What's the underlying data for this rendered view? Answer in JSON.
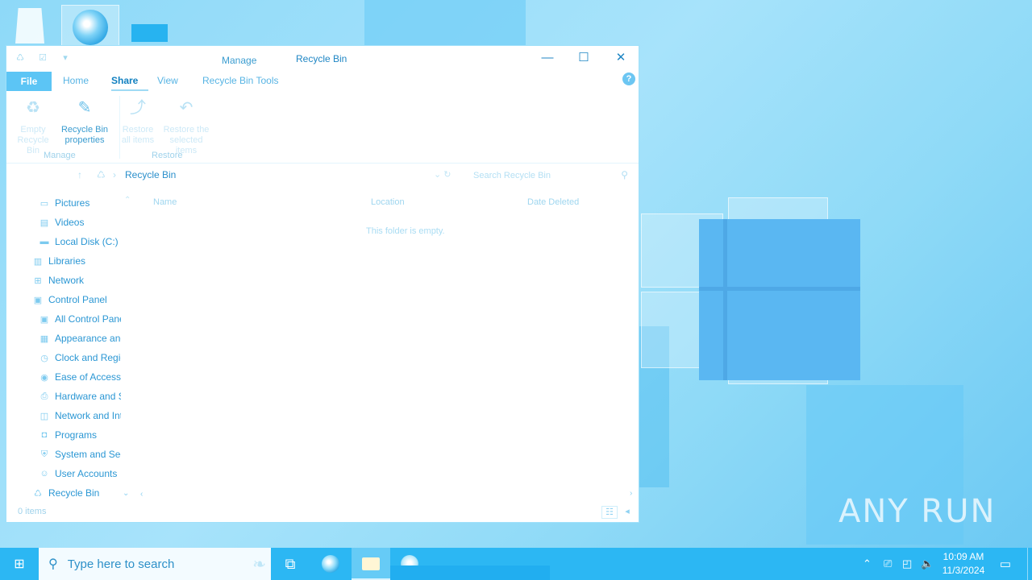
{
  "window": {
    "title": "Recycle Bin",
    "context_tab": "Manage",
    "controls": {
      "minimize": "—",
      "maximize": "☐",
      "close": "✕"
    }
  },
  "quick_access": [
    "♺",
    "☑",
    "▾"
  ],
  "ribbon": {
    "tabs": [
      "File",
      "Home",
      "Share",
      "View",
      "Recycle Bin Tools"
    ],
    "active_tab": "Share",
    "help": "?",
    "buttons": {
      "empty": "Empty Recycle Bin",
      "properties": "Recycle Bin properties",
      "restore_all": "Restore all items",
      "restore_selected": "Restore the selected items"
    },
    "groups": {
      "manage": "Manage",
      "restore": "Restore"
    }
  },
  "address": {
    "path": "Recycle Bin",
    "search_placeholder": "Search Recycle Bin"
  },
  "nav_pane": {
    "items": [
      {
        "label": "Pictures",
        "icon": "pictures-icon"
      },
      {
        "label": "Videos",
        "icon": "videos-icon"
      },
      {
        "label": "Local Disk (C:)",
        "icon": "drive-icon"
      },
      {
        "label": "Libraries",
        "icon": "libraries-icon"
      },
      {
        "label": "Network",
        "icon": "network-icon"
      },
      {
        "label": "Control Panel",
        "icon": "control-panel-icon"
      },
      {
        "label": "All Control Panel Items",
        "icon": "control-panel-icon"
      },
      {
        "label": "Appearance and Personalization",
        "icon": "appearance-icon"
      },
      {
        "label": "Clock and Region",
        "icon": "clock-icon"
      },
      {
        "label": "Ease of Access",
        "icon": "ease-of-access-icon"
      },
      {
        "label": "Hardware and Sound",
        "icon": "hardware-icon"
      },
      {
        "label": "Network and Internet",
        "icon": "network-internet-icon"
      },
      {
        "label": "Programs",
        "icon": "programs-icon"
      },
      {
        "label": "System and Security",
        "icon": "system-security-icon"
      },
      {
        "label": "User Accounts",
        "icon": "user-accounts-icon"
      },
      {
        "label": "Recycle Bin",
        "icon": "recycle-bin-icon"
      }
    ]
  },
  "content": {
    "columns": [
      "Name",
      "Location",
      "Date Deleted"
    ],
    "empty_message": "This folder is empty."
  },
  "status": {
    "count": "0 items"
  },
  "taskbar": {
    "search_placeholder": "Type here to search",
    "time": "10:09 AM",
    "date": "11/3/2024"
  },
  "watermark": "ANY RUN",
  "colors": {
    "accent": "#2cb7f3",
    "link": "#2b97d4",
    "desktop": "#8fd8f6"
  }
}
